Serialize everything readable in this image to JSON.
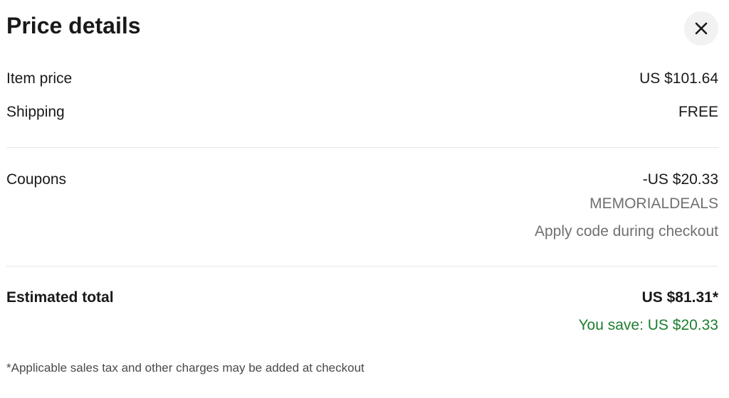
{
  "dialog": {
    "title": "Price details",
    "close_icon": "close-icon"
  },
  "items": {
    "item_price": {
      "label": "Item price",
      "value": "US $101.64"
    },
    "shipping": {
      "label": "Shipping",
      "value": "FREE"
    }
  },
  "coupons": {
    "label": "Coupons",
    "value": "-US $20.33",
    "code": "MEMORIALDEALS",
    "note": "Apply code during checkout"
  },
  "total": {
    "label": "Estimated total",
    "value": "US $81.31*",
    "savings": "You save: US $20.33"
  },
  "footnote": "*Applicable sales tax and other charges may be added at checkout",
  "colors": {
    "text": "#191919",
    "muted": "#707070",
    "savings": "#1c7e2e",
    "close_bg": "#f2f2f2",
    "divider": "#e5e5e5"
  }
}
